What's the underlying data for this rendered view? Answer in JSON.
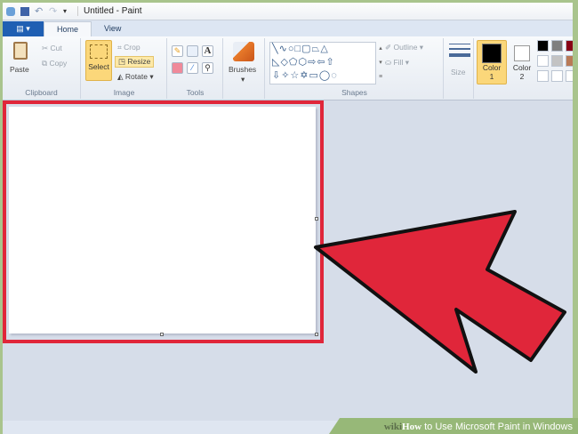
{
  "title": "Untitled - Paint",
  "tabs": [
    {
      "label": "Home"
    },
    {
      "label": "View"
    }
  ],
  "clipboard": {
    "paste": "Paste",
    "cut": "Cut",
    "copy": "Copy",
    "label": "Clipboard"
  },
  "image": {
    "select": "Select",
    "crop": "Crop",
    "resize": "Resize",
    "rotate": "Rotate",
    "label": "Image"
  },
  "tools": {
    "label": "Tools"
  },
  "brushes": {
    "label": "Brushes"
  },
  "shapes": {
    "outline": "Outline",
    "fill": "Fill",
    "label": "Shapes"
  },
  "size": {
    "label": "Size"
  },
  "colors": {
    "color1": "Color",
    "color1_num": "1",
    "color2": "Color",
    "color2_num": "2",
    "palette": [
      "#000000",
      "#7f7f7f",
      "#880015",
      "#ffffff",
      "#c3c3c3",
      "#b97a57",
      "#ffffff",
      "#ffffff",
      "#ffffff"
    ]
  },
  "annotation": {
    "arrow_color": "#e0263a",
    "box_color": "#e0263a"
  },
  "footer": {
    "wiki": "wiki",
    "how": "How",
    "rest": " to Use Microsoft Paint in Windows"
  }
}
